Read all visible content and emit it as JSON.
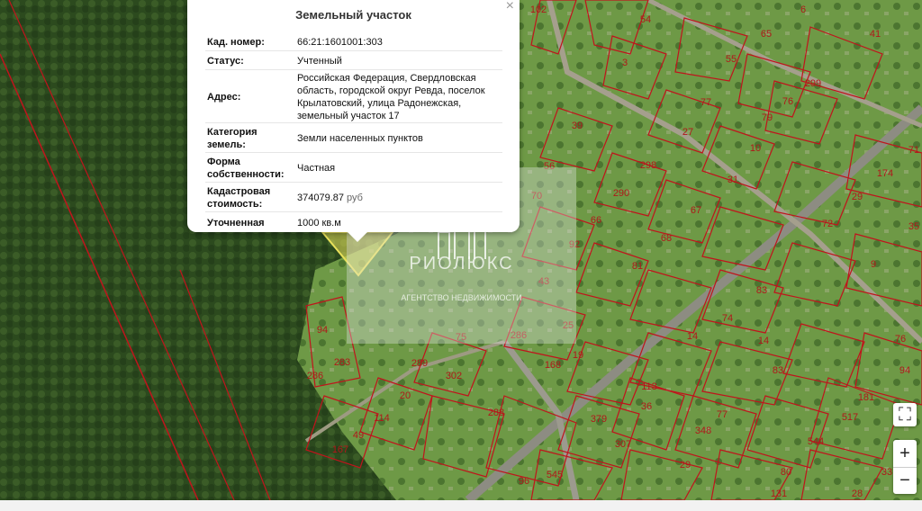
{
  "popup": {
    "title": "Земельный участок",
    "close": "×",
    "rows": [
      {
        "key": "Кад. номер:",
        "value": "66:21:1601001:303"
      },
      {
        "key": "Статус:",
        "value": "Учтенный"
      },
      {
        "key": "Адрес:",
        "value": "Российская Федерация, Свердловская область, городской округ Ревда, поселок Крылатовский, улица Радонежская, земельный участок 17"
      },
      {
        "key": "Категория земель:",
        "value": "Земли населенных пунктов"
      },
      {
        "key": "Форма собственности:",
        "value": "Частная"
      },
      {
        "key": "Кадастровая стоимость:",
        "value": "374079.87",
        "unit": "руб"
      },
      {
        "key": "Уточненная",
        "value": "1000 кв.м"
      }
    ]
  },
  "watermark": {
    "brand": "РИОЛЮКС",
    "subtitle": "АГЕНТСТВО НЕДВИЖИМОСТИ"
  },
  "controls": {
    "fullscreen": "⛶",
    "zoom_in": "+",
    "zoom_out": "−"
  },
  "parcel_numbers": [
    "102",
    "54",
    "6",
    "41",
    "65",
    "3",
    "55",
    "299",
    "76",
    "77",
    "27",
    "10",
    "79",
    "39",
    "56",
    "298",
    "31",
    "174",
    "71",
    "70",
    "290",
    "66",
    "67",
    "29",
    "72",
    "35",
    "92",
    "68",
    "81",
    "9",
    "43",
    "25",
    "83",
    "74",
    "75",
    "286",
    "14",
    "94",
    "283",
    "289",
    "302",
    "286",
    "20",
    "288",
    "168",
    "19",
    "14",
    "83",
    "76",
    "94",
    "181",
    "113",
    "36",
    "379",
    "77",
    "544",
    "517",
    "114",
    "49",
    "167",
    "348",
    "307",
    "29",
    "545",
    "96",
    "80",
    "28",
    "33",
    "131"
  ],
  "colors": {
    "parcel_border": "#c0141c",
    "forest": "#2f4a1f",
    "grass": "#6f9a45",
    "road": "#8c8c84",
    "highlight": "#e8e05a"
  }
}
